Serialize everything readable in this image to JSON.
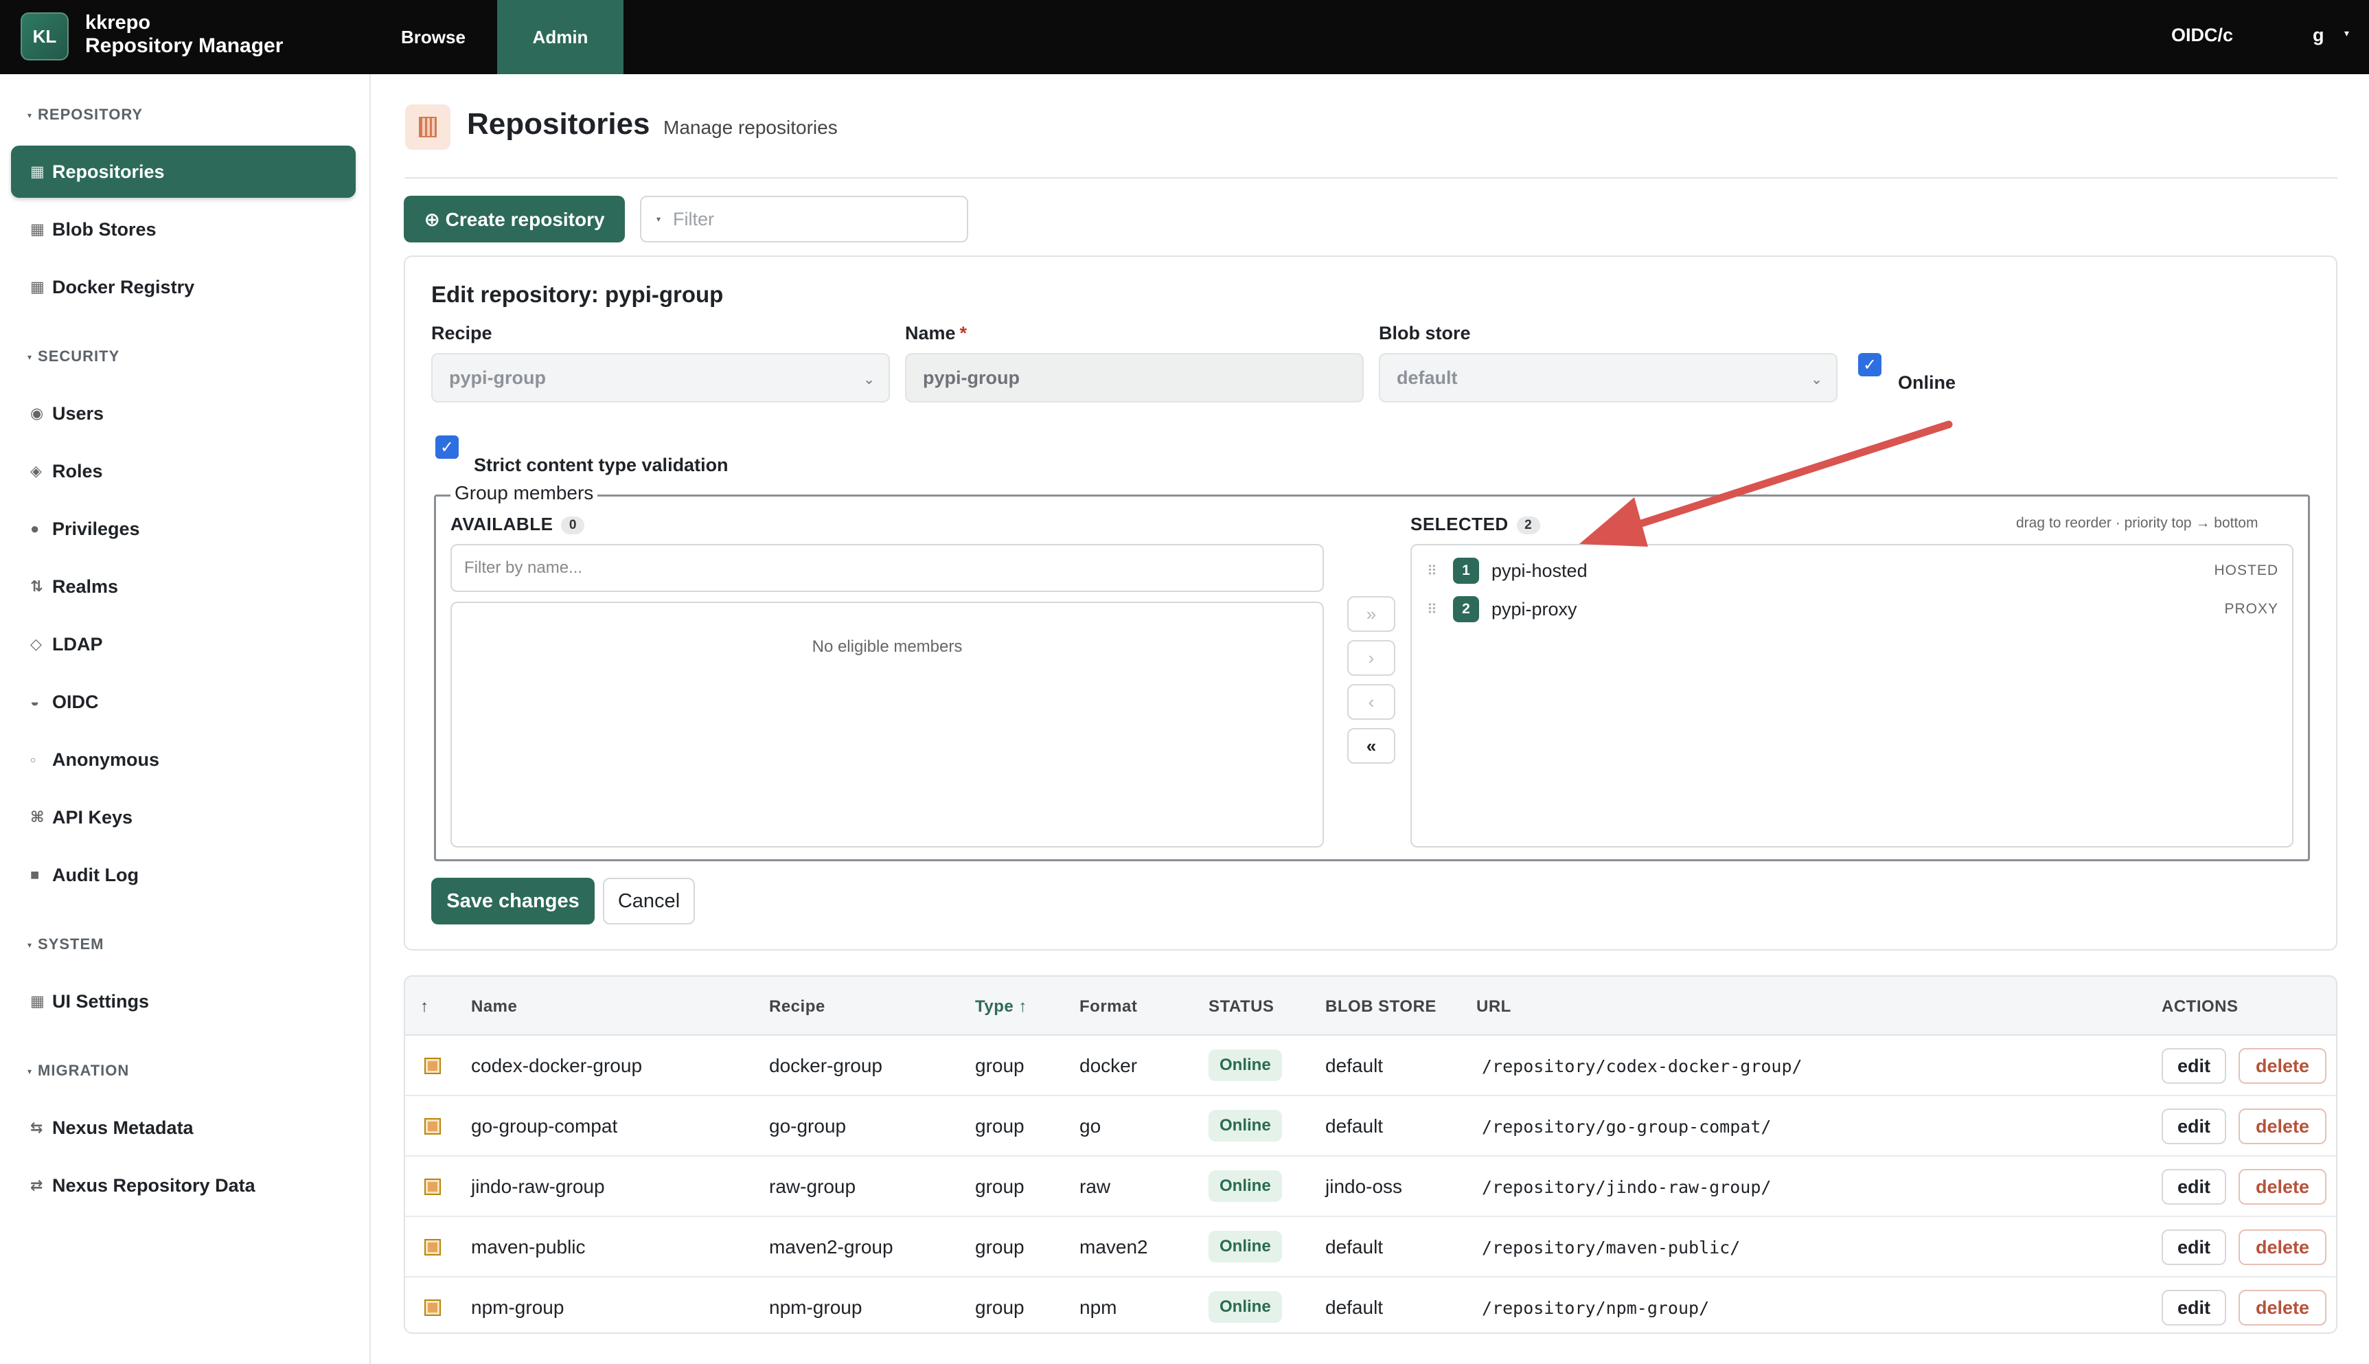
{
  "app": {
    "logo": "KL",
    "brand_line1": "kkrepo",
    "brand_line2": "Repository Manager"
  },
  "topnav": {
    "tabs": [
      {
        "label": "Browse"
      },
      {
        "label": "Admin",
        "active": true
      }
    ],
    "realm": "OIDC/c",
    "user": "g"
  },
  "sidebar": {
    "sections": [
      {
        "title": "REPOSITORY",
        "items": [
          {
            "icon": "grid-icon",
            "label": "Repositories",
            "active": true
          },
          {
            "icon": "grid-icon",
            "label": "Blob Stores"
          },
          {
            "icon": "grid-icon",
            "label": "Docker Registry"
          }
        ]
      },
      {
        "title": "SECURITY",
        "items": [
          {
            "icon": "user-icon",
            "label": "Users"
          },
          {
            "icon": "diamond-icon",
            "label": "Roles"
          },
          {
            "icon": "dot-icon",
            "label": "Privileges"
          },
          {
            "icon": "swap-icon",
            "label": "Realms"
          },
          {
            "icon": "diamond-outline-icon",
            "label": "LDAP"
          },
          {
            "icon": "half-circle-icon",
            "label": "OIDC"
          },
          {
            "icon": "circle-outline-icon",
            "label": "Anonymous"
          },
          {
            "icon": "command-icon",
            "label": "API Keys"
          },
          {
            "icon": "square-icon",
            "label": "Audit Log"
          }
        ]
      },
      {
        "title": "SYSTEM",
        "items": [
          {
            "icon": "grid-icon",
            "label": "UI Settings"
          }
        ]
      },
      {
        "title": "MIGRATION",
        "items": [
          {
            "icon": "arrows-icon",
            "label": "Nexus Metadata"
          },
          {
            "icon": "arrows-icon",
            "label": "Nexus Repository Data"
          }
        ]
      }
    ]
  },
  "page": {
    "title": "Repositories",
    "subtitle": "Manage repositories"
  },
  "toolbar": {
    "create_label": "⊕ Create repository",
    "filter_placeholder": "Filter"
  },
  "edit": {
    "title": "Edit repository: pypi-group",
    "recipe_label": "Recipe",
    "recipe_value": "pypi-group",
    "name_label": "Name",
    "name_required": "*",
    "name_value": "pypi-group",
    "blob_label": "Blob store",
    "blob_value": "default",
    "online_label": "Online",
    "online_checked": true,
    "strict_label": "Strict content type validation",
    "strict_checked": true,
    "group_legend": "Group members",
    "available_label": "AVAILABLE",
    "available_count": "0",
    "selected_label": "SELECTED",
    "selected_count": "2",
    "hint": "drag to reorder · priority top → bottom",
    "member_filter_placeholder": "Filter by name...",
    "empty_text": "No eligible members",
    "transfer_buttons": [
      "»",
      "›",
      "‹",
      "«"
    ],
    "selected": [
      {
        "index": "1",
        "name": "pypi-hosted",
        "type": "HOSTED"
      },
      {
        "index": "2",
        "name": "pypi-proxy",
        "type": "PROXY"
      }
    ],
    "save_label": "Save changes",
    "cancel_label": "Cancel"
  },
  "table": {
    "headers": {
      "sort": "↑",
      "name": "Name",
      "recipe": "Recipe",
      "type": "Type ↑",
      "format": "Format",
      "status": "STATUS",
      "blob": "BLOB STORE",
      "url": "URL",
      "actions": "ACTIONS"
    },
    "edit_label": "edit",
    "delete_label": "delete",
    "rows": [
      {
        "name": "codex-docker-group",
        "recipe": "docker-group",
        "type": "group",
        "format": "docker",
        "status": "Online",
        "blob": "default",
        "url": "/repository/codex-docker-group/"
      },
      {
        "name": "go-group-compat",
        "recipe": "go-group",
        "type": "group",
        "format": "go",
        "status": "Online",
        "blob": "default",
        "url": "/repository/go-group-compat/"
      },
      {
        "name": "jindo-raw-group",
        "recipe": "raw-group",
        "type": "group",
        "format": "raw",
        "status": "Online",
        "blob": "jindo-oss",
        "url": "/repository/jindo-raw-group/"
      },
      {
        "name": "maven-public",
        "recipe": "maven2-group",
        "type": "group",
        "format": "maven2",
        "status": "Online",
        "blob": "default",
        "url": "/repository/maven-public/"
      },
      {
        "name": "npm-group",
        "recipe": "npm-group",
        "type": "group",
        "format": "npm",
        "status": "Online",
        "blob": "default",
        "url": "/repository/npm-group/"
      }
    ]
  },
  "colors": {
    "accent": "#2d6a5a",
    "annotation_arrow": "#d9534f",
    "checkbox": "#2d6fe0"
  }
}
